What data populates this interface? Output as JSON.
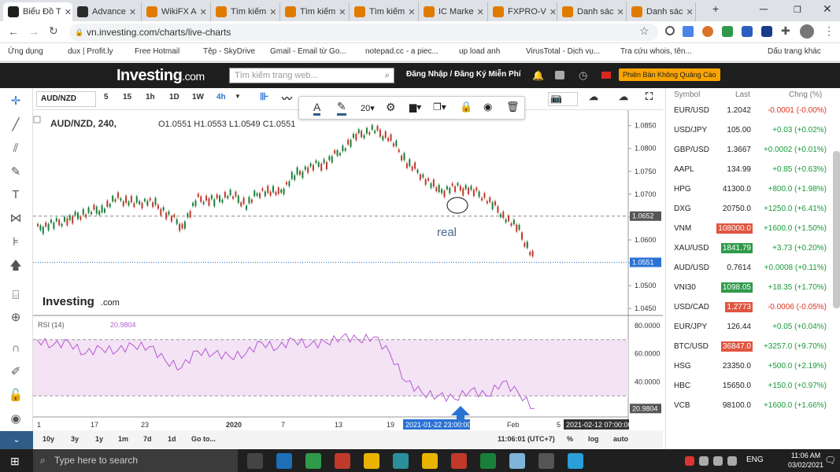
{
  "browser": {
    "tabs": [
      {
        "label": "Biểu Đồ T",
        "icon": "inv"
      },
      {
        "label": "Advance",
        "icon": "tv"
      },
      {
        "label": "WikiFX A",
        "icon": "wk"
      },
      {
        "label": "Tìm kiếm",
        "icon": "fx"
      },
      {
        "label": "Tìm kiếm",
        "icon": "fx"
      },
      {
        "label": "Tìm kiếm",
        "icon": "fx"
      },
      {
        "label": "IC Marke",
        "icon": "fx"
      },
      {
        "label": "FXPRO-V",
        "icon": "fx"
      },
      {
        "label": "Danh sác",
        "icon": "fx"
      },
      {
        "label": "Danh sác",
        "icon": "fx"
      }
    ],
    "url": "vn.investing.com/charts/live-charts",
    "bookmarks": [
      "Ứng dụng",
      "dux | Profit.ly",
      "Free Hotmail",
      "Tệp - SkyDrive",
      "Gmail - Email từ Go...",
      "notepad.cc - a piec...",
      "up load anh",
      "VirusTotal - Dịch vụ...",
      "Tra cứu whois, tên...",
      "Dấu trang khác"
    ]
  },
  "site": {
    "logo": "Investing",
    "logo_suffix": ".com",
    "search_placeholder": "Tìm kiếm trang web...",
    "login": "Đăng Nhập / Đăng Ký Miễn Phí",
    "ad_free": "Phiên Bản Không Quảng Cáo"
  },
  "chart_toolbar": {
    "symbol": "AUD/NZD",
    "intervals": [
      "5",
      "15",
      "1h",
      "1D",
      "1W",
      "4h"
    ],
    "font_size": "20"
  },
  "chart": {
    "legend": "AUD/NZD, 240,",
    "ohlc": "O1.0551  H1.0553  L1.0549  C1.0551",
    "price_ticks": [
      "1.0850",
      "1.0800",
      "1.0750",
      "1.0700",
      "1.0650",
      "1.0600",
      "1.0550",
      "1.0500",
      "1.0450"
    ],
    "hline_label": "1.0652",
    "last_label": "1.0551",
    "annotation": "real",
    "watermark": "Investing",
    "watermark_suffix": ".com",
    "rsi_legend": "RSI (14)",
    "rsi_value": "20.9804",
    "rsi_ticks": [
      "80.0000",
      "60.0000",
      "40.0000"
    ],
    "rsi_last": "20.9804",
    "date_ticks": [
      "1",
      "17",
      "23",
      "2020",
      "7",
      "13",
      "19",
      "Feb",
      "5"
    ],
    "cursor_date": "2021-01-22 23:00:00",
    "end_date": "2021-02-12 07:00:00",
    "ranges": [
      "10y",
      "3y",
      "1y",
      "1m",
      "7d",
      "1d",
      "Go to..."
    ],
    "time": "11:06:01 (UTC+7)",
    "scale_opts": [
      "%",
      "log",
      "auto"
    ]
  },
  "chart_data": {
    "type": "line",
    "title": "AUD/NZD, 240",
    "x": [
      0,
      10,
      20,
      30,
      40,
      50,
      60,
      70,
      80,
      90,
      100,
      110,
      120,
      130,
      140,
      150,
      160,
      170,
      180,
      190,
      200,
      210,
      220,
      230,
      240,
      250,
      260,
      270,
      280,
      290,
      300,
      310
    ],
    "price": [
      1.0625,
      1.0635,
      1.0645,
      1.066,
      1.0668,
      1.069,
      1.068,
      1.0685,
      1.066,
      1.063,
      1.069,
      1.0685,
      1.07,
      1.0678,
      1.071,
      1.07,
      1.074,
      1.076,
      1.077,
      1.08,
      1.083,
      1.084,
      1.082,
      1.077,
      1.074,
      1.0705,
      1.0715,
      1.071,
      1.069,
      1.0655,
      1.062,
      1.0551
    ],
    "rsi": [
      70,
      66,
      68,
      60,
      64,
      62,
      66,
      65,
      55,
      50,
      62,
      60,
      58,
      60,
      68,
      64,
      70,
      66,
      68,
      72,
      70,
      72,
      60,
      40,
      32,
      30,
      28,
      34,
      30,
      40,
      32,
      21
    ],
    "hline": 1.0652,
    "ylim": [
      1.044,
      1.087
    ],
    "rsi_ylim": [
      15,
      85
    ],
    "rsi_bands": [
      70,
      30
    ]
  },
  "watchlist": {
    "headers": [
      "Symbol",
      "Last",
      "Chng (%)"
    ],
    "rows": [
      {
        "symbol": "EUR/USD",
        "last": "1.2042",
        "chg": "-0.0001 (-0.00%)",
        "dir": "down",
        "flash": ""
      },
      {
        "symbol": "USD/JPY",
        "last": "105.00",
        "chg": "+0.03 (+0.02%)",
        "dir": "up",
        "flash": ""
      },
      {
        "symbol": "GBP/USD",
        "last": "1.3667",
        "chg": "+0.0002 (+0.01%)",
        "dir": "up",
        "flash": ""
      },
      {
        "symbol": "AAPL",
        "last": "134.99",
        "chg": "+0.85 (+0.63%)",
        "dir": "up",
        "flash": ""
      },
      {
        "symbol": "HPG",
        "last": "41300.0",
        "chg": "+800.0 (+1.98%)",
        "dir": "up",
        "flash": ""
      },
      {
        "symbol": "DXG",
        "last": "20750.0",
        "chg": "+1250.0 (+6.41%)",
        "dir": "up",
        "flash": ""
      },
      {
        "symbol": "VNM",
        "last": "108000.0",
        "chg": "+1600.0 (+1.50%)",
        "dir": "up",
        "flash": "red"
      },
      {
        "symbol": "XAU/USD",
        "last": "1841.79",
        "chg": "+3.73 (+0.20%)",
        "dir": "up",
        "flash": "green"
      },
      {
        "symbol": "AUD/USD",
        "last": "0.7614",
        "chg": "+0.0008 (+0.11%)",
        "dir": "up",
        "flash": ""
      },
      {
        "symbol": "VNI30",
        "last": "1098.05",
        "chg": "+18.35 (+1.70%)",
        "dir": "up",
        "flash": "green"
      },
      {
        "symbol": "USD/CAD",
        "last": "1.2773",
        "chg": "-0.0006 (-0.05%)",
        "dir": "down",
        "flash": "red"
      },
      {
        "symbol": "EUR/JPY",
        "last": "126.44",
        "chg": "+0.05 (+0.04%)",
        "dir": "up",
        "flash": ""
      },
      {
        "symbol": "BTC/USD",
        "last": "36847.0",
        "chg": "+3257.0 (+9.70%)",
        "dir": "up",
        "flash": "red"
      },
      {
        "symbol": "HSG",
        "last": "23350.0",
        "chg": "+500.0 (+2.19%)",
        "dir": "up",
        "flash": ""
      },
      {
        "symbol": "HBC",
        "last": "15650.0",
        "chg": "+150.0 (+0.97%)",
        "dir": "up",
        "flash": ""
      },
      {
        "symbol": "VCB",
        "last": "98100.0",
        "chg": "+1600.0 (+1.66%)",
        "dir": "up",
        "flash": ""
      }
    ]
  },
  "taskbar": {
    "search": "Type here to search",
    "lang": "ENG",
    "time": "11:06 AM",
    "date": "03/02/2021"
  },
  "colors": {
    "up": "#1a9a3a",
    "down": "#e0301e",
    "rsi": "#b45bd1",
    "rsi_band": "#f3e3f5",
    "accent": "#2a72d4"
  }
}
